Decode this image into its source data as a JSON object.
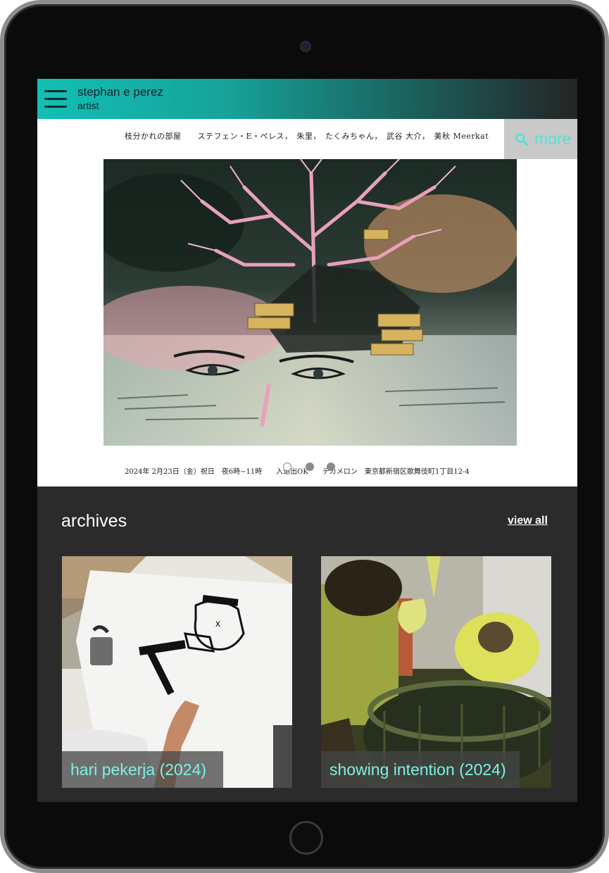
{
  "header": {
    "title": "stephan e perez",
    "subtitle": "artist"
  },
  "slide": {
    "caption_top": "枝分かれの部屋　　ステフェン・E・ペレス，　朱里，　たくみちゃん，　武谷 大介，　美秋 Meerkat",
    "caption_bottom": "2024年  2月23日（金）祝日　夜6時−11時　　入退出OK　　デカメロン　東京都新宿区歌舞伎町1丁目12-4",
    "more_label": "more",
    "dots_total": 3,
    "active_dot": 1
  },
  "archives": {
    "title": "archives",
    "view_all": "view all",
    "items": [
      {
        "label": "hari pekerja (2024)"
      },
      {
        "label": "showing intention (2024)"
      }
    ]
  },
  "colors": {
    "accent": "#7ef0e4",
    "header_gradient_start": "#12bfb4",
    "background": "#2b2b2b"
  },
  "icons": [
    "menu-icon",
    "search-icon"
  ]
}
